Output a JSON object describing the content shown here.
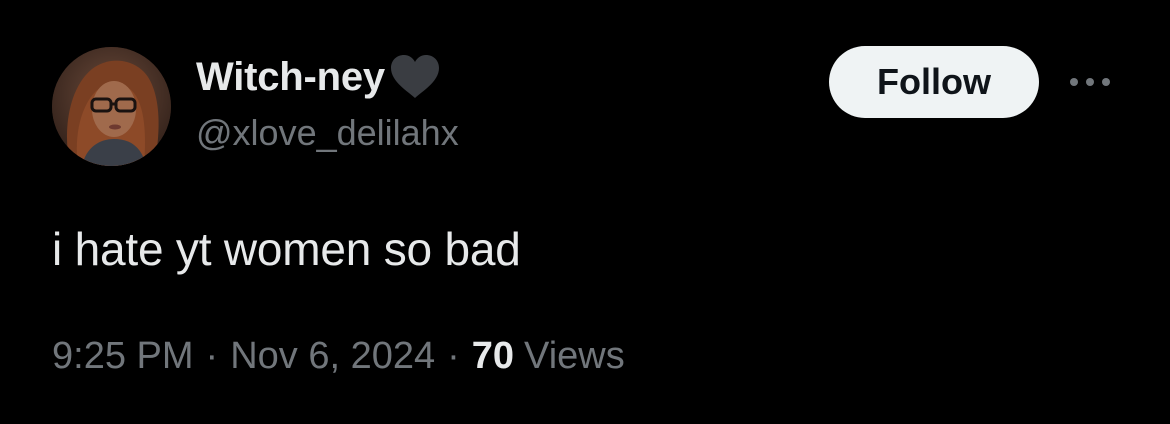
{
  "user": {
    "display_name": "Witch-ney",
    "display_name_emoji": "black-heart-icon",
    "handle": "@xlove_delilahx"
  },
  "actions": {
    "follow_label": "Follow",
    "more_icon": "more-horizontal-icon"
  },
  "tweet": {
    "text": "i hate yt women so bad"
  },
  "meta": {
    "time": "9:25 PM",
    "date": "Nov 6, 2024",
    "separator": "·",
    "views_count": "70",
    "views_label": "Views"
  },
  "colors": {
    "background": "#000000",
    "primary_text": "#e7e9ea",
    "secondary_text": "#71767b",
    "follow_bg": "#eff3f4",
    "follow_text": "#0f1419"
  }
}
